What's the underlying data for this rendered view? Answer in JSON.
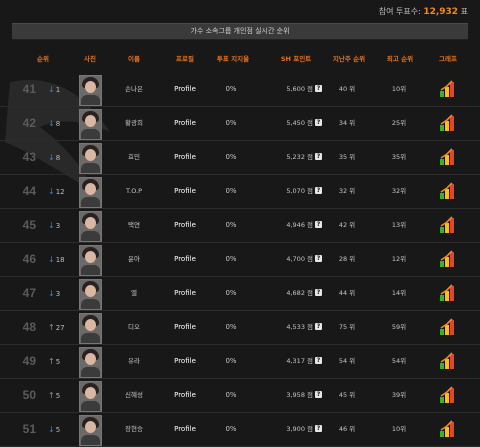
{
  "header": {
    "total_label": "참여 투표수:",
    "total_value": "12,932",
    "total_unit": "표"
  },
  "banner_title": "가수 소속그룹 개인점 실시간 순위",
  "columns": {
    "rank": "순위",
    "photo": "사진",
    "name": "이름",
    "profile": "프로필",
    "vote_rate": "투표 지지율",
    "points": "SH 포인트",
    "last_week": "지난주 순위",
    "best": "최고 순위",
    "graph": "그래프"
  },
  "rows": [
    {
      "rank": "41",
      "dir": "down",
      "change": "1",
      "name": "손나은",
      "profile": "Profile",
      "rate": "0%",
      "points": "5,600 점",
      "last": "40 위",
      "best": "10위"
    },
    {
      "rank": "42",
      "dir": "down",
      "change": "8",
      "name": "황광희",
      "profile": "Profile",
      "rate": "0%",
      "points": "5,450 점",
      "last": "34 위",
      "best": "25위"
    },
    {
      "rank": "43",
      "dir": "down",
      "change": "8",
      "name": "효민",
      "profile": "Profile",
      "rate": "0%",
      "points": "5,232 점",
      "last": "35 위",
      "best": "35위"
    },
    {
      "rank": "44",
      "dir": "down",
      "change": "12",
      "name": "T.O.P",
      "profile": "Profile",
      "rate": "0%",
      "points": "5,070 점",
      "last": "32 위",
      "best": "32위"
    },
    {
      "rank": "45",
      "dir": "down",
      "change": "3",
      "name": "택연",
      "profile": "Profile",
      "rate": "0%",
      "points": "4,946 점",
      "last": "42 위",
      "best": "13위"
    },
    {
      "rank": "46",
      "dir": "down",
      "change": "18",
      "name": "윤아",
      "profile": "Profile",
      "rate": "0%",
      "points": "4,700 점",
      "last": "28 위",
      "best": "12위"
    },
    {
      "rank": "47",
      "dir": "down",
      "change": "3",
      "name": "엘",
      "profile": "Profile",
      "rate": "0%",
      "points": "4,682 점",
      "last": "44 위",
      "best": "14위"
    },
    {
      "rank": "48",
      "dir": "up",
      "change": "27",
      "name": "디오",
      "profile": "Profile",
      "rate": "0%",
      "points": "4,533 점",
      "last": "75 위",
      "best": "59위"
    },
    {
      "rank": "49",
      "dir": "up",
      "change": "5",
      "name": "유라",
      "profile": "Profile",
      "rate": "0%",
      "points": "4,317 점",
      "last": "54 위",
      "best": "54위"
    },
    {
      "rank": "50",
      "dir": "up",
      "change": "5",
      "name": "신혜성",
      "profile": "Profile",
      "rate": "0%",
      "points": "3,958 점",
      "last": "45 위",
      "best": "39위"
    },
    {
      "rank": "51",
      "dir": "down",
      "change": "5",
      "name": "장현승",
      "profile": "Profile",
      "rate": "0%",
      "points": "3,900 점",
      "last": "46 위",
      "best": "10위"
    }
  ],
  "colors": {
    "accent": "#e7731a",
    "down_arrow": "#4d78c8",
    "up_arrow": "#e77b1e"
  },
  "icons": {
    "info": "question-icon",
    "graph": "graph-icon"
  }
}
